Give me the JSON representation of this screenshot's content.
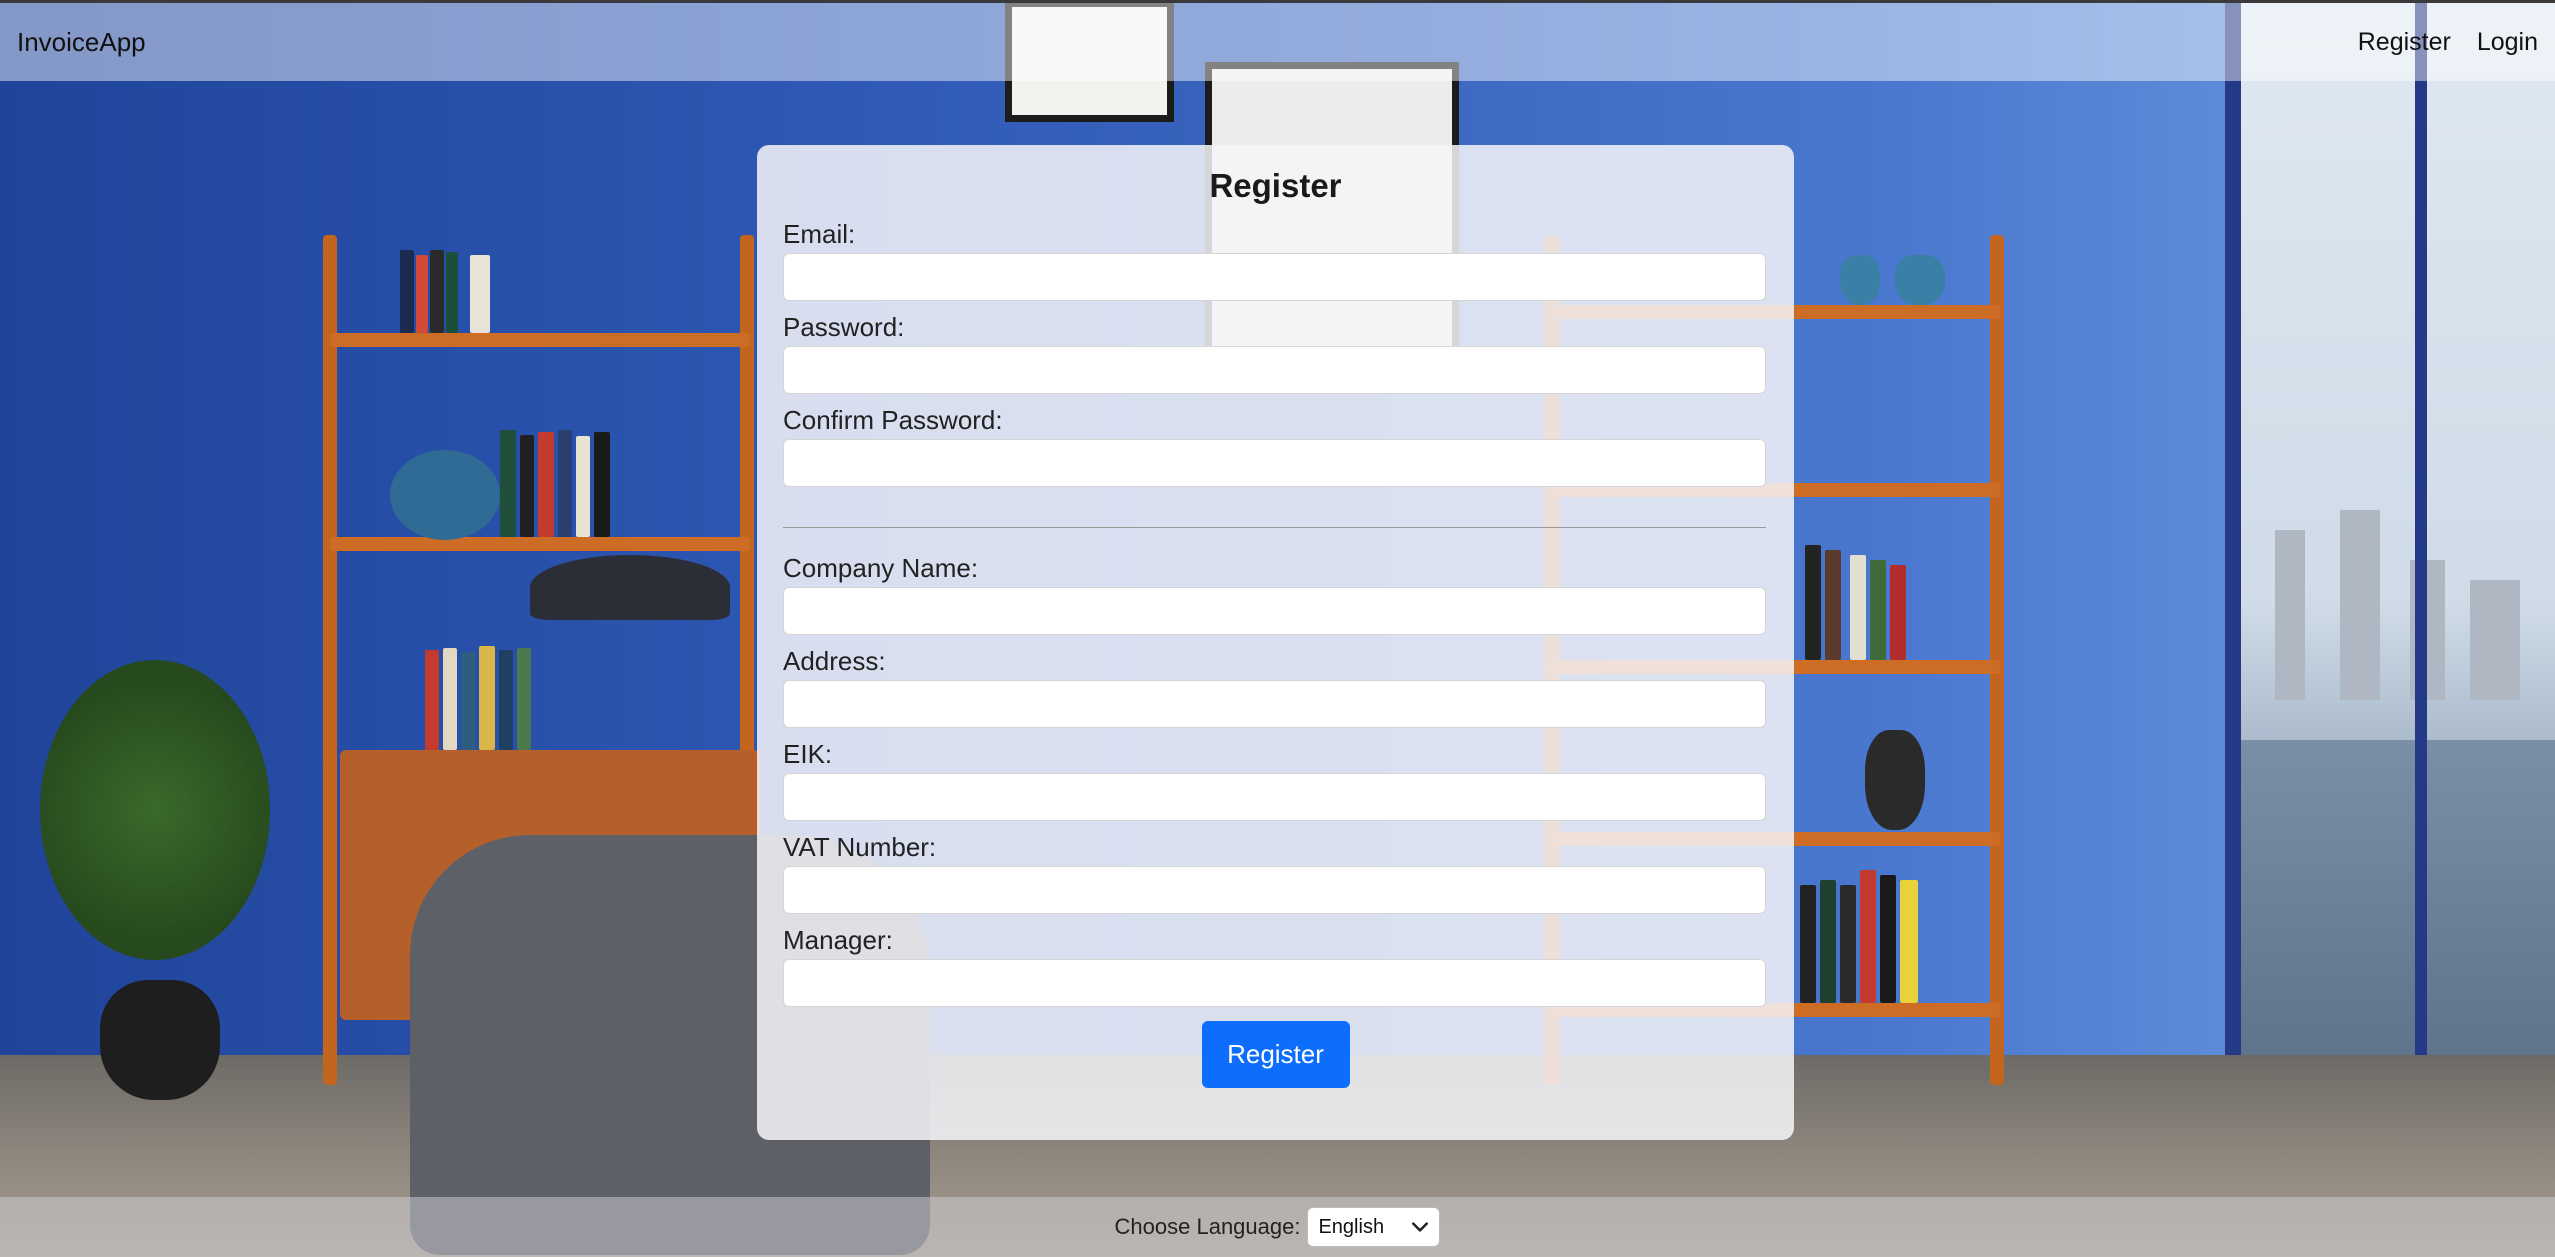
{
  "navbar": {
    "brand": "InvoiceApp",
    "links": [
      {
        "label": "Register"
      },
      {
        "label": "Login"
      }
    ]
  },
  "form": {
    "title": "Register",
    "account_fields": [
      {
        "label": "Email:",
        "value": ""
      },
      {
        "label": "Password:",
        "value": ""
      },
      {
        "label": "Confirm Password:",
        "value": ""
      }
    ],
    "company_fields": [
      {
        "label": "Company Name:",
        "value": ""
      },
      {
        "label": "Address:",
        "value": ""
      },
      {
        "label": "EIK:",
        "value": ""
      },
      {
        "label": "VAT Number:",
        "value": ""
      },
      {
        "label": "Manager:",
        "value": ""
      }
    ],
    "submit_label": "Register"
  },
  "footer": {
    "language_label": "Choose Language:",
    "language_selected": "English",
    "dropdown_icon": "chevron-down-icon"
  },
  "colors": {
    "primary_button": "#0d6efd"
  }
}
